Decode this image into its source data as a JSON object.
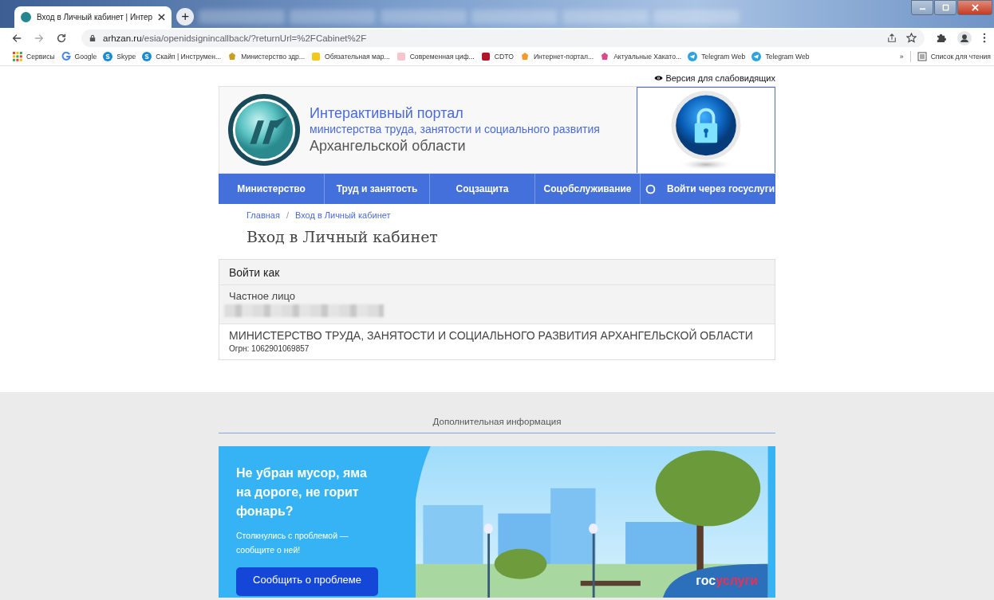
{
  "browser": {
    "active_tab": {
      "title": "Вход в Личный кабинет | Интер"
    },
    "new_tab": "+",
    "address": {
      "host": "arhzan.ru",
      "path": "/esia/openidsignincallback/?returnUrl=%2FCabinet%2F"
    },
    "bookmarks": [
      {
        "label": "Сервисы",
        "kind": "grid"
      },
      {
        "label": "Google",
        "kind": "google",
        "color": "#4285f4"
      },
      {
        "label": "Skype",
        "kind": "skype",
        "color": "#1a8ad6"
      },
      {
        "label": "Скайп | Инструмен...",
        "kind": "skype",
        "color": "#1a8ad6"
      },
      {
        "label": "Министерство здр...",
        "kind": "emblem",
        "color": "#c8a020"
      },
      {
        "label": "Обязательная мар...",
        "kind": "square",
        "color": "#f2c81c"
      },
      {
        "label": "Современная циф...",
        "kind": "square",
        "color": "#f7c6cc"
      },
      {
        "label": "CDTO",
        "kind": "square",
        "color": "#b0182a"
      },
      {
        "label": "Интернет-портал...",
        "kind": "emblem",
        "color": "#f29b2b"
      },
      {
        "label": "Актуальные Хакато...",
        "kind": "emblem",
        "color": "#d94a8c"
      },
      {
        "label": "Telegram Web",
        "kind": "telegram",
        "color": "#2aa3df"
      },
      {
        "label": "Telegram Web",
        "kind": "telegram",
        "color": "#2aa3df"
      }
    ],
    "more": "»",
    "reading_list": "Список для чтения"
  },
  "page": {
    "accessibility_link": "Версия для слабовидящих",
    "portal_title": "Интерактивный портал",
    "portal_subtitle": "министерства труда, занятости и социального развития",
    "portal_region": "Архангельской области",
    "nav": [
      {
        "label": "Министерство",
        "kind": "link"
      },
      {
        "label": "Труд и занятость",
        "kind": "link"
      },
      {
        "label": "Соцзащита",
        "kind": "link"
      },
      {
        "label": "Соцобслуживание",
        "kind": "link"
      },
      {
        "label": "Войти через госуслуги",
        "kind": "login"
      }
    ],
    "breadcrumbs": [
      "Главная",
      "Вход в Личный кабинет"
    ],
    "breadcrumb_separator": "/",
    "heading": "Вход в Личный кабинет",
    "login_card": {
      "title": "Войти как",
      "options": [
        {
          "name": "Частное лицо",
          "redacted": true,
          "selected": true
        },
        {
          "name": "МИНИСТЕРСТВО ТРУДА, ЗАНЯТОСТИ И СОЦИАЛЬНОГО РАЗВИТИЯ АРХАНГЕЛЬСКОЙ ОБЛАСТИ",
          "detail": "Огрн: 1062901069857",
          "redacted": false,
          "selected": false
        }
      ]
    },
    "extra_info": {
      "title": "Дополнительная информация",
      "banner": {
        "headline": "Не убран мусор, яма на дороге, не горит фонарь?",
        "text": "Столкнулись с проблемой — сообщите о ней!",
        "button": "Сообщить о проблеме",
        "logo_first": "гос",
        "logo_second": "услуги"
      }
    }
  }
}
